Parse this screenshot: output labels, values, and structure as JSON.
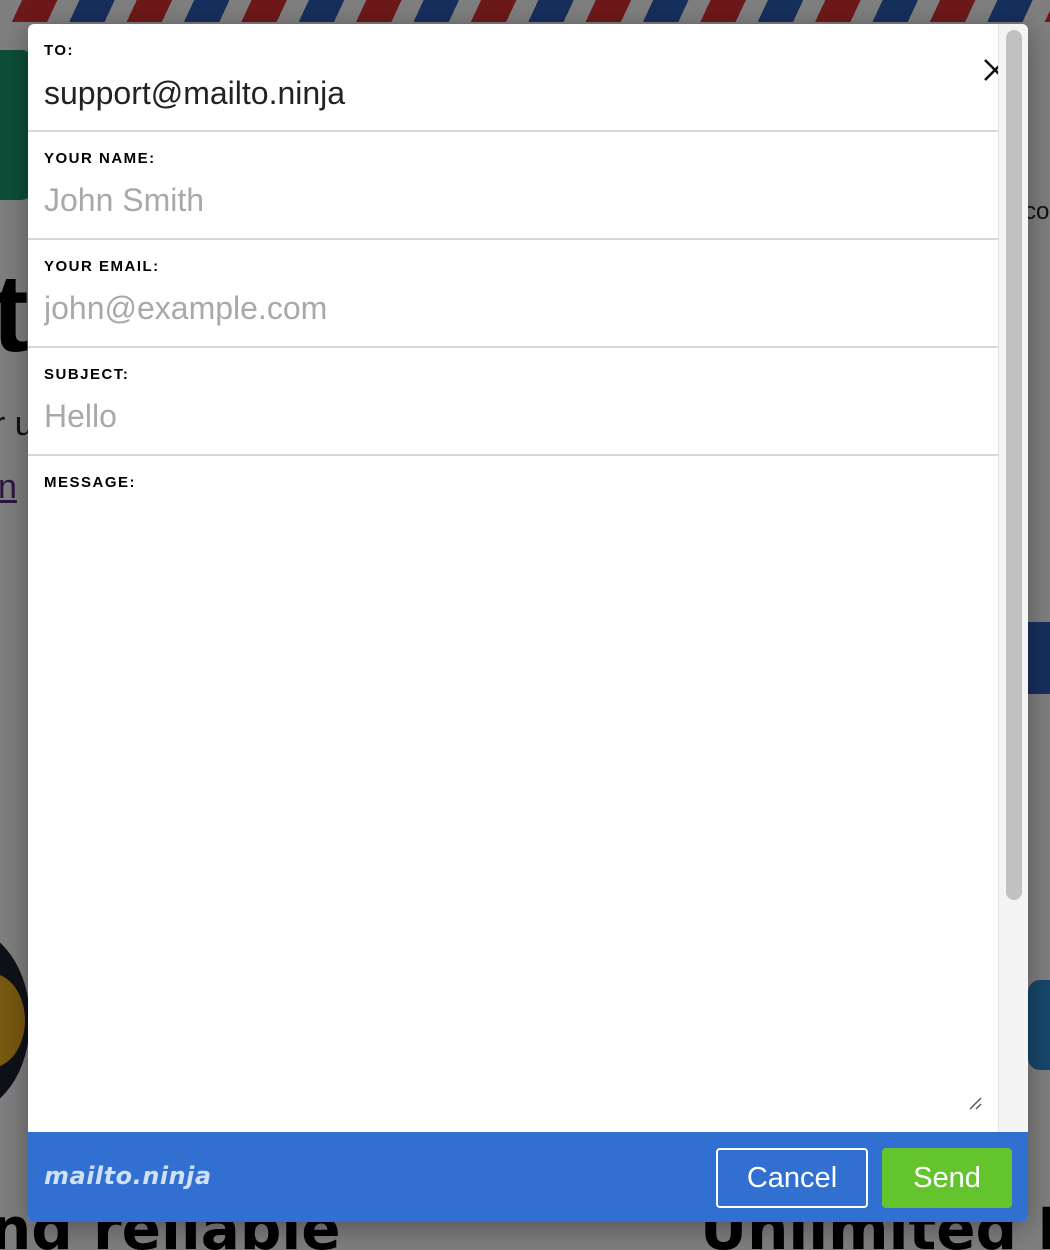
{
  "modal": {
    "to_label": "To:",
    "to_value": "support@mailto.ninja",
    "name_label": "Your Name:",
    "name_placeholder": "John Smith",
    "email_label": "Your Email:",
    "email_placeholder": "john@example.com",
    "subject_label": "Subject:",
    "subject_placeholder": "Hello",
    "message_label": "Message:",
    "message_value": ""
  },
  "footer": {
    "brand": "mailto.ninja",
    "cancel_label": "Cancel",
    "send_label": "Send"
  },
  "background": {
    "big_letter": "t",
    "fragment_u": "r u",
    "fragment_n": "n",
    "fragment_co": "co",
    "bottom_left_text": "nd reliable",
    "bottom_right_text": "Unlimited M"
  },
  "colors": {
    "footer_bg": "#3170d0",
    "send_bg": "#64c42e",
    "placeholder": "#a9a9a9",
    "overlay": "rgba(0,0,0,0.5)"
  },
  "icons": {
    "close": "close-icon",
    "resize": "resize-grip-icon"
  }
}
